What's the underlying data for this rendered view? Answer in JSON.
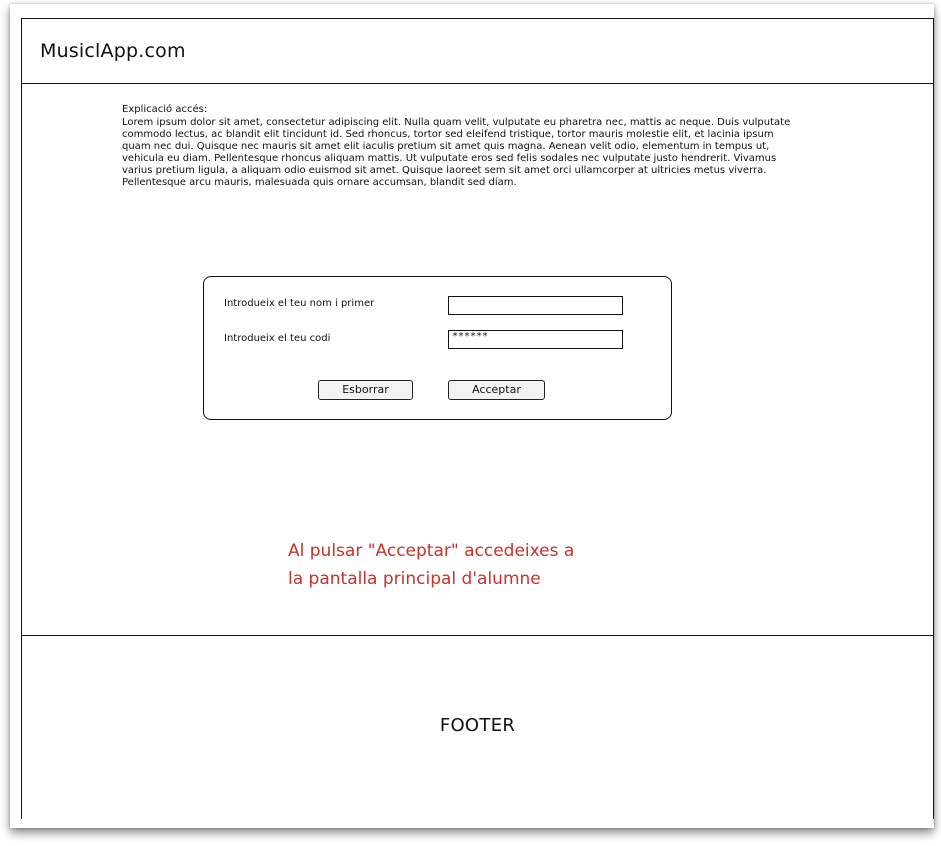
{
  "header": {
    "title": "MusiclApp.com"
  },
  "intro": {
    "heading": "Explicació accés:",
    "text": "Lorem ipsum dolor sit amet, consectetur adipiscing elit. Nulla quam velit, vulputate eu pharetra nec, mattis ac neque. Duis vulputate commodo lectus, ac blandit elit tincidunt id. Sed rhoncus, tortor sed eleifend tristique, tortor mauris molestie elit, et lacinia ipsum quam nec dui. Quisque nec mauris sit amet elit iaculis pretium sit amet quis magna. Aenean velit odio, elementum in tempus ut, vehicula eu diam. Pellentesque rhoncus aliquam mattis. Ut vulputate eros sed felis sodales nec vulputate justo hendrerit. Vivamus varius pretium ligula, a aliquam odio euismod sit amet. Quisque laoreet sem sit amet orci ullamcorper at ultricies metus viverra. Pellentesque arcu mauris, malesuada quis ornare accumsan, blandit sed diam."
  },
  "login": {
    "name_label": "Introdueix el teu nom i primer",
    "name_value": "",
    "code_label": "Introdueix el teu codi",
    "code_value": "******",
    "clear_button": "Esborrar",
    "accept_button": "Acceptar"
  },
  "note": {
    "line1": "Al pulsar \"Acceptar\" accedeixes a",
    "line2": "la pantalla principal d'alumne",
    "color": "#c8322b"
  },
  "footer": {
    "text": "FOOTER"
  }
}
